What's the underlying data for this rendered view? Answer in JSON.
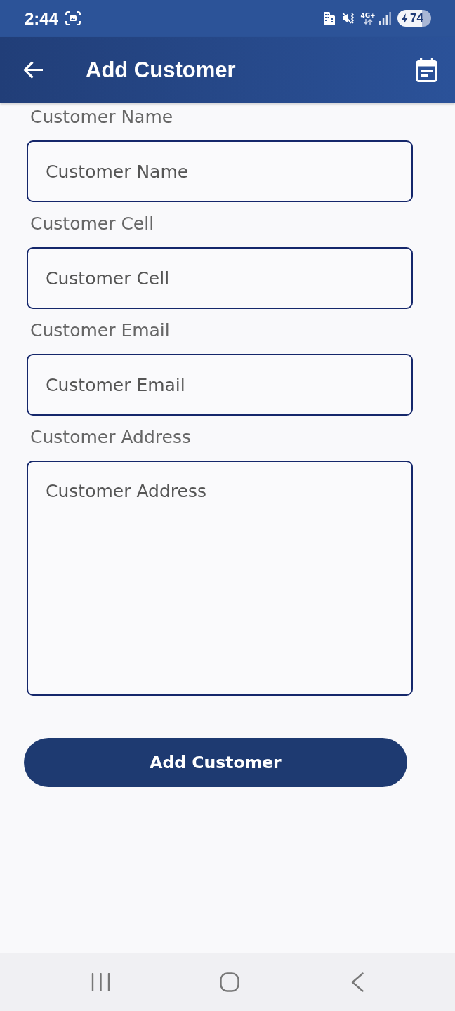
{
  "status_bar": {
    "time": "2:44",
    "network_type": "4G+",
    "battery": "74"
  },
  "app_bar": {
    "title": "Add Customer"
  },
  "form": {
    "fields": [
      {
        "kind": "text",
        "label": "Customer Name",
        "placeholder": "Customer Name"
      },
      {
        "kind": "phone",
        "label": "Customer Cell",
        "placeholder": "Customer Cell"
      },
      {
        "kind": "email",
        "label": "Customer Email",
        "placeholder": "Customer Email"
      },
      {
        "kind": "multiline",
        "label": "Customer Address",
        "placeholder": "Customer Address"
      }
    ],
    "submit_button": {
      "label": "Add Customer"
    }
  }
}
